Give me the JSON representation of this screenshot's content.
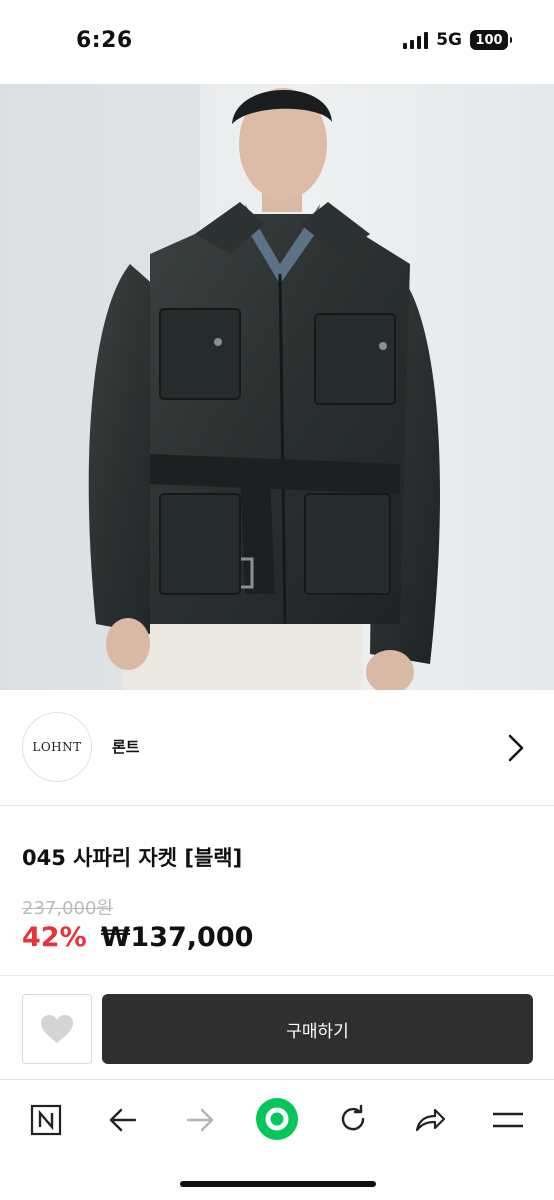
{
  "status_bar": {
    "time": "6:26",
    "network": "5G",
    "battery": "100"
  },
  "product_image": {
    "icon": "product-photo-leather-jacket"
  },
  "seller": {
    "logo_text": "LOHNT",
    "name": "론트"
  },
  "product": {
    "title": "045 사파리 자켓 [블랙]",
    "original_price": "237,000원",
    "discount": "42%",
    "sale_price": "₩137,000"
  },
  "actions": {
    "buy_label": "구매하기"
  },
  "colors": {
    "discount": "#e8323c",
    "buy_button": "#2f2f2f",
    "naver_green": "#03c75a"
  },
  "toolbar_icons": [
    "naver-n-icon",
    "back-arrow-icon",
    "forward-arrow-icon",
    "green-home-icon",
    "reload-icon",
    "share-icon",
    "menu-icon"
  ]
}
